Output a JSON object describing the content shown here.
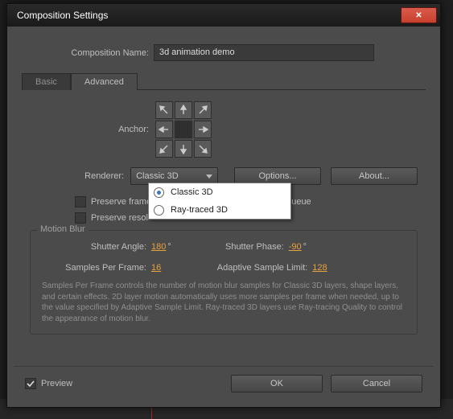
{
  "window": {
    "title": "Composition Settings"
  },
  "header": {
    "comp_name_label": "Composition Name:",
    "comp_name_value": "3d animation demo"
  },
  "tabs": {
    "basic": "Basic",
    "advanced": "Advanced",
    "active": "advanced"
  },
  "advanced": {
    "anchor_label": "Anchor:",
    "renderer_label": "Renderer:",
    "renderer_value": "Classic 3D",
    "renderer_options": [
      "Classic 3D",
      "Ray-traced 3D"
    ],
    "options_btn": "Options...",
    "about_btn": "About...",
    "preserve_framerate_label": "Preserve frame",
    "preserve_framerate_suffix": "ueue",
    "preserve_resolution_label": "Preserve resol",
    "preserve_framerate_checked": false,
    "preserve_resolution_checked": false
  },
  "motion_blur": {
    "legend": "Motion Blur",
    "shutter_angle_label": "Shutter Angle:",
    "shutter_angle_value": "180",
    "shutter_angle_unit": "°",
    "shutter_phase_label": "Shutter Phase:",
    "shutter_phase_value": "-90",
    "shutter_phase_unit": "°",
    "samples_per_frame_label": "Samples Per Frame:",
    "samples_per_frame_value": "16",
    "adaptive_limit_label": "Adaptive Sample Limit:",
    "adaptive_limit_value": "128",
    "help": "Samples Per Frame controls the number of motion blur samples for Classic 3D layers, shape layers, and certain effects. 2D layer motion automatically uses more samples per frame when needed, up to the value specified by Adaptive Sample Limit. Ray-traced 3D layers use Ray-tracing Quality to control the appearance of motion blur."
  },
  "footer": {
    "preview_label": "Preview",
    "preview_checked": true,
    "ok": "OK",
    "cancel": "Cancel"
  }
}
